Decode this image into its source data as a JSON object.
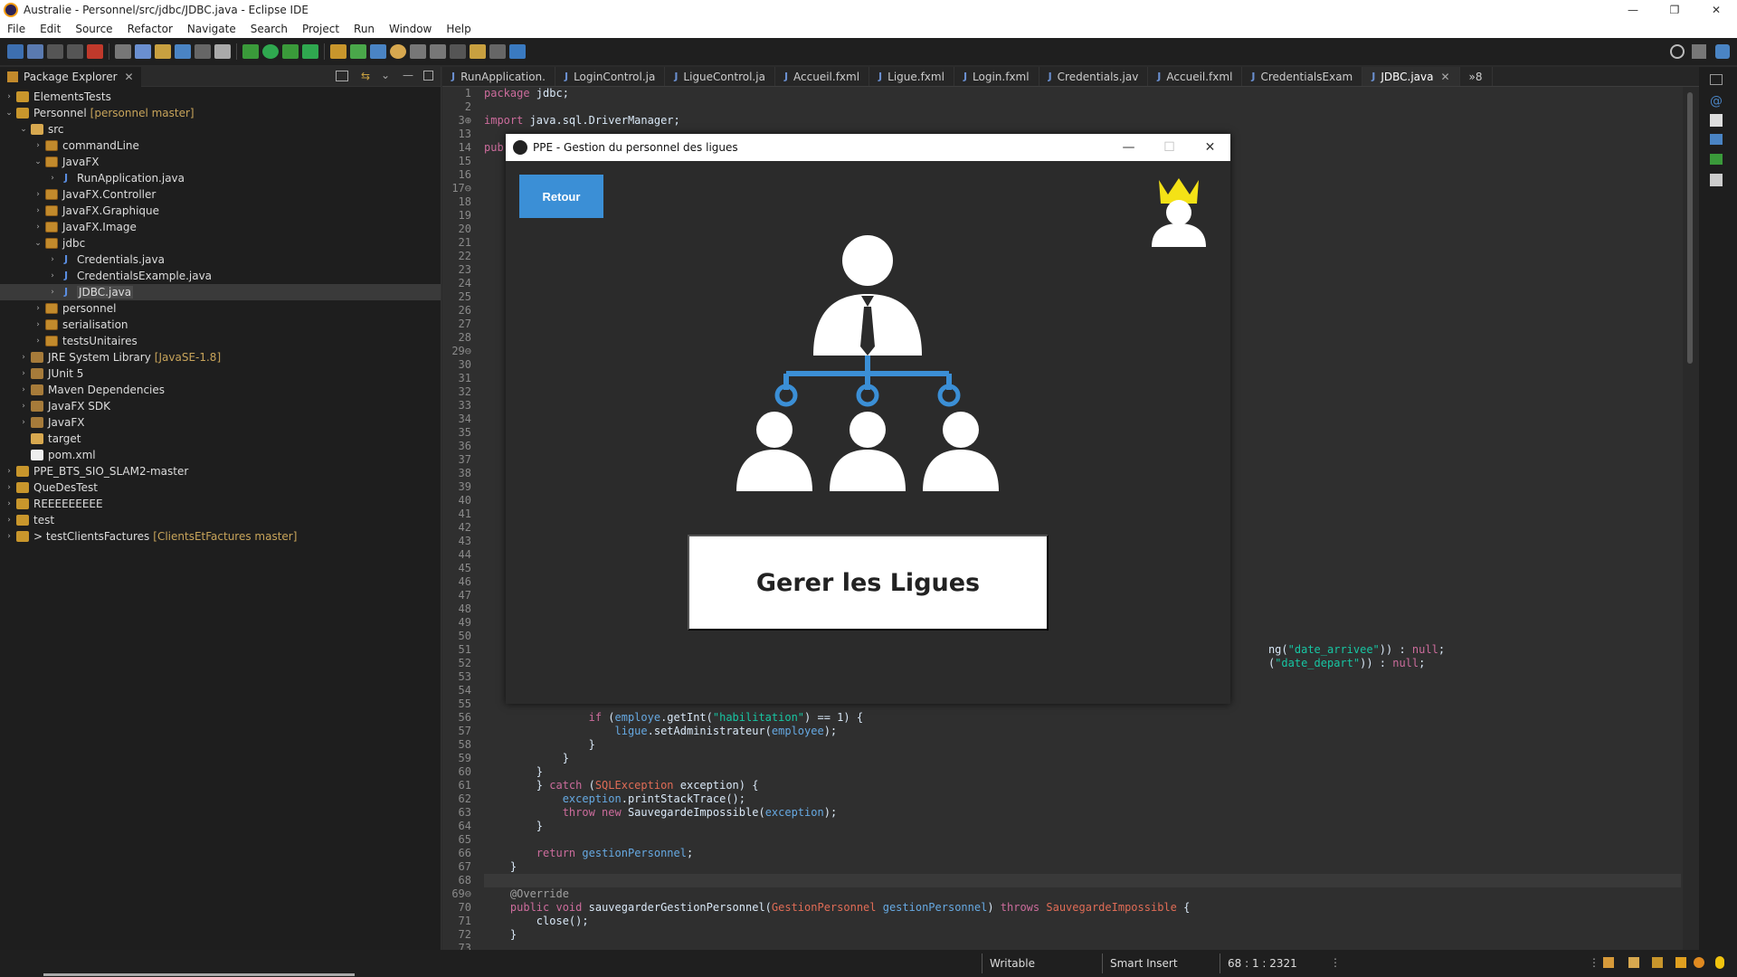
{
  "window": {
    "title": "Australie - Personnel/src/jdbc/JDBC.java - Eclipse IDE"
  },
  "menu": [
    "File",
    "Edit",
    "Source",
    "Refactor",
    "Navigate",
    "Search",
    "Project",
    "Run",
    "Window",
    "Help"
  ],
  "explorer": {
    "title": "Package Explorer",
    "tree": [
      {
        "label": "ElementsTests",
        "depth": 0,
        "arrow": "›",
        "icon": "proj"
      },
      {
        "label": "Personnel",
        "deco": "[personnel master]",
        "depth": 0,
        "arrow": "⌄",
        "icon": "proj"
      },
      {
        "label": "src",
        "depth": 1,
        "arrow": "⌄",
        "icon": "folder"
      },
      {
        "label": "commandLine",
        "depth": 2,
        "arrow": "›",
        "icon": "pkg"
      },
      {
        "label": "JavaFX",
        "depth": 2,
        "arrow": "⌄",
        "icon": "pkg"
      },
      {
        "label": "RunApplication.java",
        "depth": 3,
        "arrow": "›",
        "icon": "java"
      },
      {
        "label": "JavaFX.Controller",
        "depth": 2,
        "arrow": "›",
        "icon": "pkg"
      },
      {
        "label": "JavaFX.Graphique",
        "depth": 2,
        "arrow": "›",
        "icon": "pkg"
      },
      {
        "label": "JavaFX.Image",
        "depth": 2,
        "arrow": "›",
        "icon": "pkg"
      },
      {
        "label": "jdbc",
        "depth": 2,
        "arrow": "⌄",
        "icon": "pkg"
      },
      {
        "label": "Credentials.java",
        "depth": 3,
        "arrow": "›",
        "icon": "java"
      },
      {
        "label": "CredentialsExample.java",
        "depth": 3,
        "arrow": "›",
        "icon": "java"
      },
      {
        "label": "JDBC.java",
        "depth": 3,
        "arrow": "›",
        "icon": "java",
        "selected": true
      },
      {
        "label": "personnel",
        "depth": 2,
        "arrow": "›",
        "icon": "pkg"
      },
      {
        "label": "serialisation",
        "depth": 2,
        "arrow": "›",
        "icon": "pkg"
      },
      {
        "label": "testsUnitaires",
        "depth": 2,
        "arrow": "›",
        "icon": "pkg"
      },
      {
        "label": "JRE System Library",
        "deco": "[JavaSE-1.8]",
        "depth": 1,
        "arrow": "›",
        "icon": "lib"
      },
      {
        "label": "JUnit 5",
        "depth": 1,
        "arrow": "›",
        "icon": "lib"
      },
      {
        "label": "Maven Dependencies",
        "depth": 1,
        "arrow": "›",
        "icon": "lib"
      },
      {
        "label": "JavaFX SDK",
        "depth": 1,
        "arrow": "›",
        "icon": "lib"
      },
      {
        "label": "JavaFX",
        "depth": 1,
        "arrow": "›",
        "icon": "lib"
      },
      {
        "label": "target",
        "depth": 1,
        "arrow": "",
        "icon": "folder"
      },
      {
        "label": "pom.xml",
        "depth": 1,
        "arrow": "",
        "icon": "xml"
      },
      {
        "label": "PPE_BTS_SIO_SLAM2-master",
        "depth": 0,
        "arrow": "›",
        "icon": "proj"
      },
      {
        "label": "QueDesTest",
        "depth": 0,
        "arrow": "›",
        "icon": "proj"
      },
      {
        "label": "REEEEEEEEE",
        "depth": 0,
        "arrow": "›",
        "icon": "proj"
      },
      {
        "label": "test",
        "depth": 0,
        "arrow": "›",
        "icon": "proj"
      },
      {
        "label": "> testClientsFactures",
        "deco": "[ClientsEtFactures master]",
        "depth": 0,
        "arrow": "›",
        "icon": "proj"
      }
    ]
  },
  "editor_tabs": [
    {
      "label": "RunApplication."
    },
    {
      "label": "LoginControl.ja"
    },
    {
      "label": "LigueControl.ja"
    },
    {
      "label": "Accueil.fxml"
    },
    {
      "label": "Ligue.fxml"
    },
    {
      "label": "Login.fxml"
    },
    {
      "label": "Credentials.jav"
    },
    {
      "label": "Accueil.fxml"
    },
    {
      "label": "CredentialsExam"
    },
    {
      "label": "JDBC.java",
      "active": true
    }
  ],
  "tabs_overflow": "»8",
  "code_lines": [
    {
      "n": "1",
      "html": "<span class='kw'>package</span> jdbc;"
    },
    {
      "n": "2",
      "html": ""
    },
    {
      "n": "3⊕",
      "html": "<span class='kw'>import</span> java.sql.DriverManager;"
    },
    {
      "n": "13",
      "html": ""
    },
    {
      "n": "14",
      "html": "<span class='kw'>pub</span>"
    },
    {
      "n": "15",
      "html": ""
    },
    {
      "n": "16",
      "html": ""
    },
    {
      "n": "17⊖",
      "html": ""
    },
    {
      "n": "18",
      "html": ""
    },
    {
      "n": "19",
      "html": ""
    },
    {
      "n": "20",
      "html": ""
    },
    {
      "n": "21",
      "html": ""
    },
    {
      "n": "22",
      "html": ""
    },
    {
      "n": "23",
      "html": ""
    },
    {
      "n": "24",
      "html": ""
    },
    {
      "n": "25",
      "html": ""
    },
    {
      "n": "26",
      "html": ""
    },
    {
      "n": "27",
      "html": ""
    },
    {
      "n": "28",
      "html": ""
    },
    {
      "n": "29⊖",
      "html": ""
    },
    {
      "n": "30",
      "html": ""
    },
    {
      "n": "31",
      "html": ""
    },
    {
      "n": "32",
      "html": ""
    },
    {
      "n": "33",
      "html": ""
    },
    {
      "n": "34",
      "html": ""
    },
    {
      "n": "35",
      "html": ""
    },
    {
      "n": "36",
      "html": ""
    },
    {
      "n": "37",
      "html": ""
    },
    {
      "n": "38",
      "html": ""
    },
    {
      "n": "39",
      "html": ""
    },
    {
      "n": "40",
      "html": ""
    },
    {
      "n": "41",
      "html": ""
    },
    {
      "n": "42",
      "html": ""
    },
    {
      "n": "43",
      "html": ""
    },
    {
      "n": "44",
      "html": ""
    },
    {
      "n": "45",
      "html": ""
    },
    {
      "n": "46",
      "html": ""
    },
    {
      "n": "47",
      "html": ""
    },
    {
      "n": "48",
      "html": ""
    },
    {
      "n": "49",
      "html": ""
    },
    {
      "n": "50",
      "html": ""
    },
    {
      "n": "51",
      "html": "                                                                                                                        ng(<span class='str'>\"date_arrivee\"</span>)) : <span class='kw'>null</span>;"
    },
    {
      "n": "52",
      "html": "                                                                                                                        (<span class='str'>\"date_depart\"</span>)) : <span class='kw'>null</span>;"
    },
    {
      "n": "53",
      "html": ""
    },
    {
      "n": "54",
      "html": ""
    },
    {
      "n": "55",
      "html": ""
    },
    {
      "n": "56",
      "html": "                <span class='kw'>if</span> (<span class='fld'>employe</span>.getInt(<span class='str'>\"habilitation\"</span>) == 1) {"
    },
    {
      "n": "57",
      "html": "                    <span class='fld'>ligue</span>.setAdministrateur(<span class='fld'>employee</span>);"
    },
    {
      "n": "58",
      "html": "                }"
    },
    {
      "n": "59",
      "html": "            }"
    },
    {
      "n": "60",
      "html": "        }"
    },
    {
      "n": "61",
      "html": "        } <span class='kw'>catch</span> (<span class='typ'>SQLException</span> exception) {"
    },
    {
      "n": "62",
      "html": "            <span class='fld'>exception</span>.printStackTrace();"
    },
    {
      "n": "63",
      "html": "            <span class='kw'>throw new</span> SauvegardeImpossible(<span class='fld'>exception</span>);"
    },
    {
      "n": "64",
      "html": "        }"
    },
    {
      "n": "65",
      "html": ""
    },
    {
      "n": "66",
      "html": "        <span class='kw'>return</span> <span class='fld'>gestionPersonnel</span>;"
    },
    {
      "n": "67",
      "html": "    }"
    },
    {
      "n": "68",
      "html": "",
      "cur": true
    },
    {
      "n": "69⊖",
      "html": "    <span class='ann'>@Override</span>"
    },
    {
      "n": "70",
      "html": "    <span class='kw'>public void</span> sauvegarderGestionPersonnel(<span class='typ'>GestionPersonnel</span> <span class='fld'>gestionPersonnel</span>) <span class='kw'>throws</span> <span class='typ'>SauvegardeImpossible</span> {"
    },
    {
      "n": "71",
      "html": "        close();"
    },
    {
      "n": "72",
      "html": "    }"
    },
    {
      "n": "73",
      "html": ""
    }
  ],
  "dialog": {
    "title": "PPE - Gestion du personnel des ligues",
    "retour_label": "Retour",
    "gerer_label": "Gerer les Ligues",
    "accent": "#3b8fd6"
  },
  "status": {
    "writable": "Writable",
    "insert": "Smart Insert",
    "position": "68 : 1 : 2321"
  }
}
